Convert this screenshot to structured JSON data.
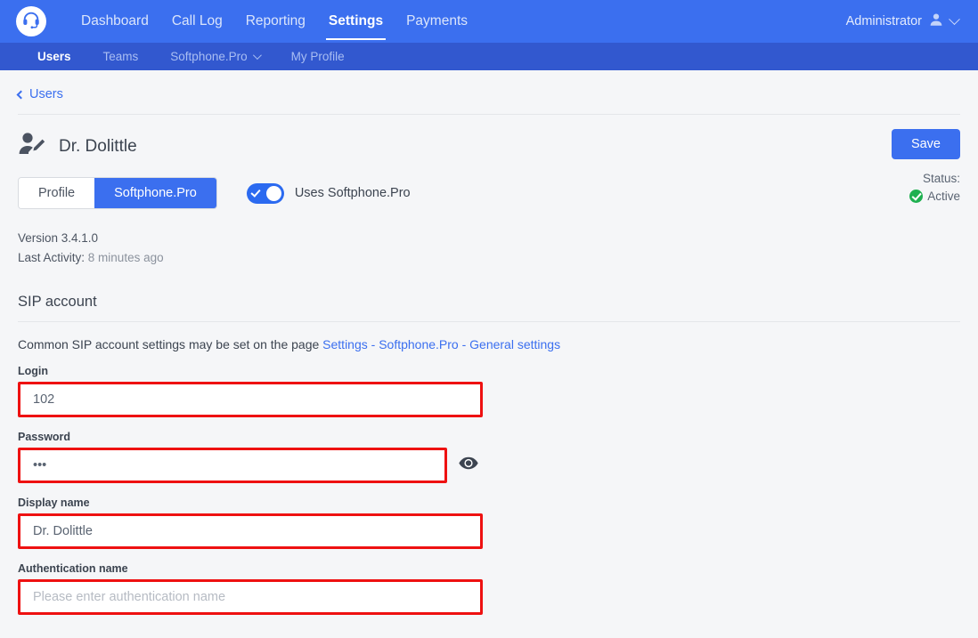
{
  "header": {
    "logo_icon": "headset-icon",
    "nav": [
      {
        "label": "Dashboard",
        "active": false
      },
      {
        "label": "Call Log",
        "active": false
      },
      {
        "label": "Reporting",
        "active": false
      },
      {
        "label": "Settings",
        "active": true
      },
      {
        "label": "Payments",
        "active": false
      }
    ],
    "account_label": "Administrator",
    "account_icon": "user-icon",
    "account_chevron": "chevron-down-icon"
  },
  "subnav": [
    {
      "label": "Users",
      "active": true
    },
    {
      "label": "Teams",
      "active": false
    },
    {
      "label": "Softphone.Pro",
      "active": false,
      "has_chevron": true
    },
    {
      "label": "My Profile",
      "active": false
    }
  ],
  "breadcrumb": {
    "back_icon": "chevron-left-icon",
    "label": "Users"
  },
  "user": {
    "avatar_icon": "user-edit-icon",
    "name": "Dr. Dolittle"
  },
  "actions": {
    "save_label": "Save",
    "status_label": "Status:",
    "status_value": "Active",
    "status_icon": "check-circle-icon"
  },
  "tabs": [
    {
      "label": "Profile",
      "active": false
    },
    {
      "label": "Softphone.Pro",
      "active": true
    }
  ],
  "toggle": {
    "label": "Uses Softphone.Pro",
    "checked": true
  },
  "meta": {
    "version_label": "Version 3.4.1.0",
    "activity_label": "Last Activity:",
    "activity_value": "8 minutes ago"
  },
  "sip": {
    "section_title": "SIP account",
    "helper_text": "Common SIP account settings may be set on the page ",
    "helper_link": "Settings - Softphone.Pro - General settings",
    "fields": [
      {
        "label": "Login",
        "value": "102",
        "placeholder": ""
      },
      {
        "label": "Password",
        "value": "•••",
        "placeholder": "",
        "has_eye": true,
        "eye_icon": "eye-icon"
      },
      {
        "label": "Display name",
        "value": "Dr. Dolittle",
        "placeholder": ""
      },
      {
        "label": "Authentication name",
        "value": "",
        "placeholder": "Please enter authentication name"
      }
    ]
  },
  "colors": {
    "brand_blue": "#3b6fef",
    "subnav_blue": "#3258cf",
    "highlight_red": "#ee1111",
    "status_green": "#1eb050",
    "page_bg": "#f5f6f8"
  }
}
